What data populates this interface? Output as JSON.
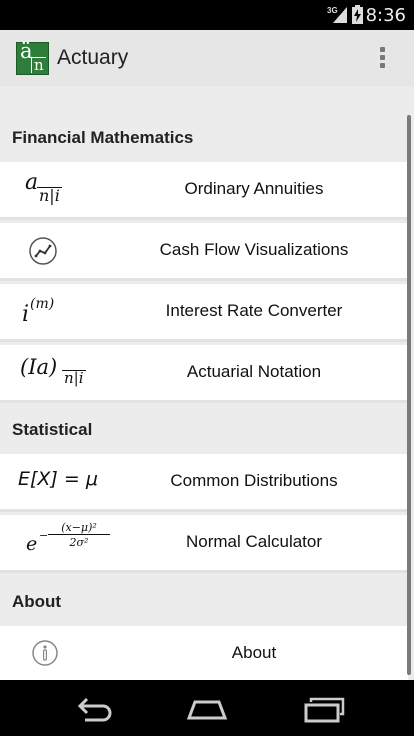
{
  "status_bar": {
    "network": "3G",
    "time": "8:36"
  },
  "app_bar": {
    "logo_top": "ä",
    "logo_bottom": "n",
    "title": "Actuary"
  },
  "sections": [
    {
      "header": "Financial Mathematics",
      "items": [
        {
          "label": "Ordinary Annuities",
          "icon": "annuity-formula-icon"
        },
        {
          "label": "Cash Flow Visualizations",
          "icon": "line-chart-icon"
        },
        {
          "label": "Interest Rate Converter",
          "icon": "interest-rate-formula-icon"
        },
        {
          "label": "Actuarial Notation",
          "icon": "increasing-annuity-formula-icon"
        }
      ]
    },
    {
      "header": "Statistical",
      "items": [
        {
          "label": "Common Distributions",
          "icon": "expectation-formula-icon"
        },
        {
          "label": "Normal Calculator",
          "icon": "normal-density-formula-icon"
        }
      ]
    },
    {
      "header": "About",
      "items": [
        {
          "label": "About",
          "icon": "info-icon"
        }
      ]
    }
  ],
  "formulas": {
    "annuity_a": "a",
    "annuity_sub": "n|i",
    "interest_i": "i",
    "interest_sup": "(m)",
    "actuarial_main": "(Ia)",
    "actuarial_sub": "n|i",
    "expectation": "E[X] = μ",
    "normal_base": "e",
    "normal_num": "(x−μ)²",
    "normal_den": "2σ²"
  },
  "nav_bar": {
    "back": "back-icon",
    "home": "home-icon",
    "recents": "recents-icon"
  }
}
